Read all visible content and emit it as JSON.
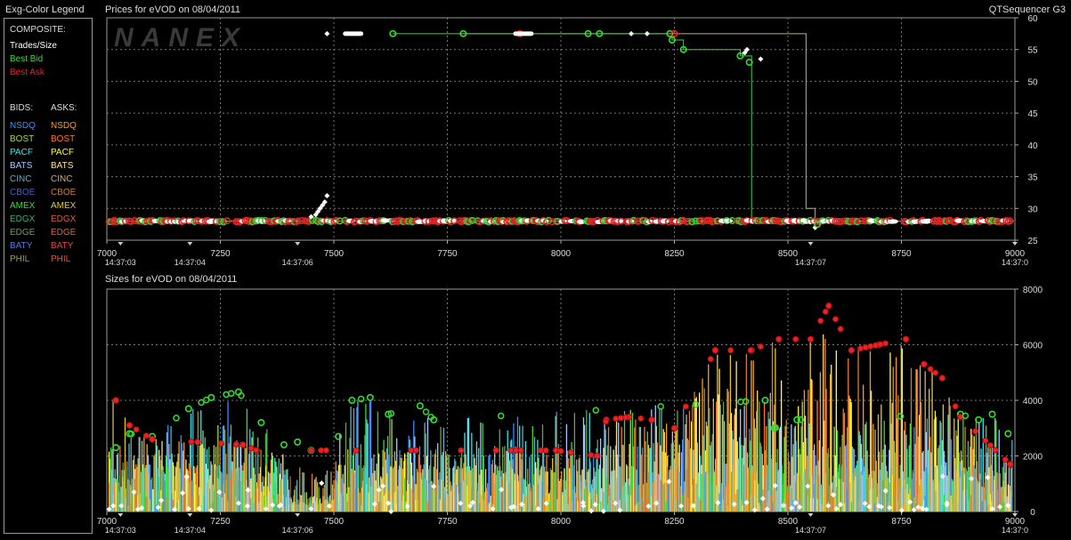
{
  "legend": {
    "title": "Exg-Color Legend",
    "composite_header": "COMPOSITE:",
    "composite": [
      {
        "label": "Trades/Size",
        "color": "#ffffff"
      },
      {
        "label": "Best Bid",
        "color": "#33dd33"
      },
      {
        "label": "Best Ask",
        "color": "#ee2222"
      }
    ],
    "bids_header": "BIDS:",
    "asks_header": "ASKS:",
    "exchanges": [
      {
        "bid": "NSDQ",
        "ask": "NSDQ",
        "bid_color": "#3c8cff",
        "ask_color": "#ff9a1e"
      },
      {
        "bid": "BOST",
        "ask": "BOST",
        "bid_color": "#9fd85a",
        "ask_color": "#ff7733"
      },
      {
        "bid": "PACF",
        "ask": "PACF",
        "bid_color": "#2fe8e8",
        "ask_color": "#ffff33"
      },
      {
        "bid": "BATS",
        "ask": "BATS",
        "bid_color": "#a6c8ff",
        "ask_color": "#ffe08a"
      },
      {
        "bid": "CINC",
        "ask": "CINC",
        "bid_color": "#5fb0c8",
        "ask_color": "#c8b46e"
      },
      {
        "bid": "CBOE",
        "ask": "CBOE",
        "bid_color": "#3c5fd8",
        "ask_color": "#d87a28"
      },
      {
        "bid": "AMEX",
        "ask": "AMEX",
        "bid_color": "#33dd33",
        "ask_color": "#e6c828"
      },
      {
        "bid": "EDGX",
        "ask": "EDGX",
        "bid_color": "#3cae6e",
        "ask_color": "#e05c3c"
      },
      {
        "bid": "EDGE",
        "ask": "EDGE",
        "bid_color": "#6ea05a",
        "ask_color": "#e0642a"
      },
      {
        "bid": "BATY",
        "ask": "BATY",
        "bid_color": "#5a78e0",
        "ask_color": "#e04646"
      },
      {
        "bid": "PHIL",
        "ask": "PHIL",
        "bid_color": "#9aa05a",
        "ask_color": "#d85a5a"
      }
    ]
  },
  "header": {
    "prices_title": "Prices for  eVOD  on  08/04/2011",
    "app_name": "QTSequencer G3",
    "sizes_title": "Sizes for  eVOD  on  08/04/2011",
    "watermark": "NANEX"
  },
  "chart_data": [
    {
      "type": "scatter",
      "title": "Prices for  eVOD  on  08/04/2011",
      "xlim": [
        7000,
        9000
      ],
      "ylim": [
        25,
        60
      ],
      "x_ticks": [
        7000,
        7250,
        7500,
        7750,
        8000,
        8250,
        8500,
        8750,
        9000
      ],
      "x_tick_labels": [
        "7000",
        "7250",
        "7500",
        "7750",
        "8000",
        "8250",
        "8500",
        "8750",
        "9000"
      ],
      "y_ticks": [
        25,
        30,
        35,
        40,
        45,
        50,
        55,
        60
      ],
      "y_tick_labels": [
        "25",
        "30",
        "35",
        "40",
        "45",
        "50",
        "55",
        "60"
      ],
      "time_labels": [
        {
          "x": 7030,
          "label": "14:37:03"
        },
        {
          "x": 7183,
          "label": "14:37:04"
        },
        {
          "x": 7420,
          "label": "14:37:06"
        },
        {
          "x": 8550,
          "label": "14:37:07"
        },
        {
          "x": 9000,
          "label": "14:37:0"
        }
      ],
      "grid": true,
      "baseline_price": 28,
      "best_ask_line": [
        [
          7780,
          57.5
        ],
        [
          8540,
          57.5
        ],
        [
          8540,
          30
        ],
        [
          8560,
          30
        ],
        [
          8560,
          28
        ]
      ],
      "best_bid_line": [
        [
          7630,
          57.5
        ],
        [
          8245,
          57.5
        ],
        [
          8245,
          56.5
        ],
        [
          8270,
          56.5
        ],
        [
          8270,
          55
        ],
        [
          8395,
          55
        ],
        [
          8395,
          54
        ],
        [
          8420,
          54
        ],
        [
          8420,
          28
        ],
        [
          8560,
          28
        ]
      ],
      "series": [
        {
          "name": "Trades/Size",
          "color": "#ffffff",
          "points": [
            [
              7485,
              57.5
            ],
            [
              7485,
              32
            ],
            [
              7480,
              31
            ],
            [
              7475,
              30.5
            ],
            [
              7470,
              30
            ],
            [
              7465,
              29.5
            ],
            [
              7460,
              29
            ],
            [
              7450,
              28.7
            ],
            [
              8155,
              57.5
            ],
            [
              8190,
              57.5
            ],
            [
              8405,
              54.5
            ],
            [
              8410,
              55
            ],
            [
              8440,
              53.5
            ],
            [
              8560,
              27
            ]
          ]
        },
        {
          "name": "Best Bid",
          "color": "#33dd33",
          "points": [
            [
              7630,
              57.5
            ],
            [
              7785,
              57.5
            ],
            [
              8060,
              57.5
            ],
            [
              8085,
              57.5
            ],
            [
              8240,
              57.5
            ],
            [
              8245,
              56.5
            ],
            [
              8270,
              55
            ],
            [
              8395,
              54
            ],
            [
              8415,
              53
            ],
            [
              8565,
              27.5
            ]
          ]
        },
        {
          "name": "Best Ask",
          "color": "#ee2222",
          "points": [
            [
              7910,
              57.5
            ],
            [
              8250,
              57.5
            ]
          ]
        }
      ]
    },
    {
      "type": "bar",
      "title": "Sizes for  eVOD  on  08/04/2011",
      "xlim": [
        7000,
        9000
      ],
      "ylim": [
        0,
        8000
      ],
      "x_ticks": [
        7000,
        7250,
        7500,
        7750,
        8000,
        8250,
        8500,
        8750,
        9000
      ],
      "x_tick_labels": [
        "7000",
        "7250",
        "7500",
        "7750",
        "8000",
        "8250",
        "8500",
        "8750",
        "9000"
      ],
      "y_ticks": [
        0,
        2000,
        4000,
        6000,
        8000
      ],
      "y_tick_labels": [
        "0",
        "2000",
        "4000",
        "6000",
        "8000"
      ],
      "time_labels": [
        {
          "x": 7030,
          "label": "14:37:03"
        },
        {
          "x": 7183,
          "label": "14:37:04"
        },
        {
          "x": 7420,
          "label": "14:37:06"
        },
        {
          "x": 8550,
          "label": "14:37:07"
        },
        {
          "x": 9000,
          "label": "14:37:0"
        }
      ],
      "grid": true,
      "bid_size_envelope": [
        [
          7020,
          2300
        ],
        [
          7050,
          2800
        ],
        [
          7100,
          2700
        ],
        [
          7180,
          3700
        ],
        [
          7230,
          4100
        ],
        [
          7290,
          4300
        ],
        [
          7340,
          3200
        ],
        [
          7390,
          2400
        ],
        [
          7420,
          2500
        ],
        [
          7450,
          2200
        ],
        [
          7510,
          2700
        ],
        [
          7540,
          4000
        ],
        [
          7580,
          4100
        ],
        [
          7620,
          3500
        ],
        [
          7690,
          3800
        ],
        [
          7720,
          3300
        ],
        [
          8450,
          4000
        ],
        [
          8470,
          3000
        ],
        [
          8520,
          3300
        ],
        [
          8880,
          3500
        ],
        [
          8920,
          3300
        ],
        [
          8950,
          3500
        ],
        [
          8985,
          2800
        ]
      ],
      "ask_size_envelope": [
        [
          7020,
          4000
        ],
        [
          7050,
          3100
        ],
        [
          7100,
          2600
        ],
        [
          7200,
          2500
        ],
        [
          7300,
          2400
        ],
        [
          7330,
          2200
        ],
        [
          7990,
          2200
        ],
        [
          8080,
          2000
        ],
        [
          8100,
          3300
        ],
        [
          8150,
          3400
        ],
        [
          8200,
          3300
        ],
        [
          8250,
          3000
        ],
        [
          8340,
          5800
        ],
        [
          8420,
          5800
        ],
        [
          8480,
          6200
        ],
        [
          8550,
          6200
        ],
        [
          8590,
          7400
        ],
        [
          8640,
          5800
        ],
        [
          8700,
          6000
        ],
        [
          8760,
          6200
        ],
        [
          8800,
          5300
        ],
        [
          8840,
          4800
        ],
        [
          8880,
          3400
        ],
        [
          8990,
          1700
        ]
      ],
      "trade_sizes": [
        [
          7060,
          700
        ],
        [
          7120,
          400
        ],
        [
          7180,
          100
        ],
        [
          7230,
          50
        ],
        [
          7290,
          300
        ],
        [
          7310,
          200
        ],
        [
          7350,
          100
        ],
        [
          7380,
          200
        ],
        [
          7450,
          100
        ],
        [
          7490,
          200
        ],
        [
          7620,
          300
        ],
        [
          7720,
          900
        ],
        [
          7800,
          200
        ],
        [
          7850,
          100
        ],
        [
          7890,
          150
        ],
        [
          7950,
          100
        ],
        [
          8050,
          200
        ],
        [
          8120,
          300
        ],
        [
          8210,
          300
        ],
        [
          8600,
          600
        ],
        [
          8700,
          200
        ],
        [
          8850,
          300
        ],
        [
          8950,
          100
        ]
      ],
      "series": [
        {
          "name": "NSDQ",
          "color": "#3c8cff"
        },
        {
          "name": "NSDQ",
          "color": "#ff9a1e"
        },
        {
          "name": "PACF",
          "color": "#ffff33"
        }
      ]
    }
  ]
}
